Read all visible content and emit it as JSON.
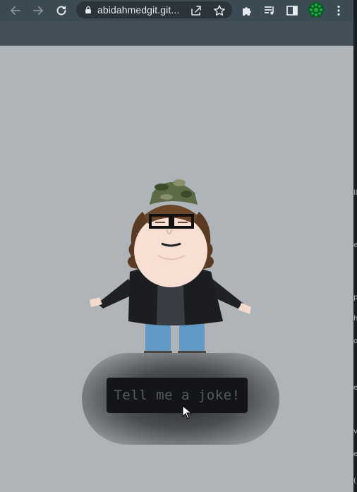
{
  "browser": {
    "url": "abidahmedgit.git...",
    "toolbar_icons": [
      "back-icon",
      "forward-icon",
      "reload-icon",
      "lock-icon",
      "share-icon",
      "star-icon",
      "extensions-icon",
      "media-icon",
      "side-panel-icon",
      "avatar",
      "menu-icon"
    ]
  },
  "page": {
    "background_color": "#aeb4b7",
    "character": "caricature-man-in-camo-cap",
    "button": {
      "label": "Tell me a joke!"
    }
  },
  "edge_text": [
    "ll",
    "e",
    "p",
    "h",
    "o",
    "e",
    "v",
    "e",
    "("
  ]
}
